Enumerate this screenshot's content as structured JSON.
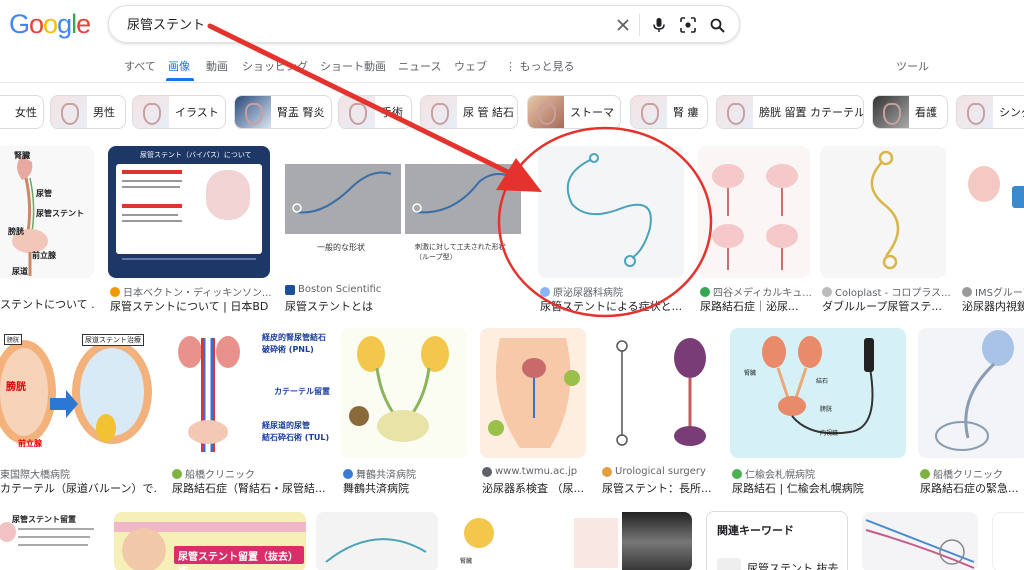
{
  "logo": {
    "letters": [
      "G",
      "o",
      "o",
      "g",
      "l",
      "e"
    ],
    "colors": [
      "#4285F4",
      "#EA4335",
      "#FBBC05",
      "#4285F4",
      "#34A853",
      "#EA4335"
    ]
  },
  "search": {
    "query": "尿管ステント"
  },
  "tabs": [
    {
      "label": "すべて",
      "active": false
    },
    {
      "label": "画像",
      "active": true
    },
    {
      "label": "動画",
      "active": false
    },
    {
      "label": "ショッピング",
      "active": false
    },
    {
      "label": "ショート動画",
      "active": false
    },
    {
      "label": "ニュース",
      "active": false
    },
    {
      "label": "ウェブ",
      "active": false
    },
    {
      "label": "⋮ もっと見る",
      "active": false
    }
  ],
  "tools_label": "ツール",
  "chips": [
    "女性",
    "男性",
    "イラスト",
    "腎盂 腎炎",
    "手術",
    "尿 管 結石",
    "ストーマ",
    "腎 瘻",
    "膀胱 留置 カテーテル",
    "看護",
    "シング"
  ],
  "results_row1": [
    {
      "source": "",
      "title": "ステントについて ..."
    },
    {
      "source": "日本ベクトン・ディッキンソン...",
      "title": "尿管ステントについて | 日本BD"
    },
    {
      "source": "Boston Scientific",
      "title": "尿管ステントとは"
    },
    {
      "source": "原泌尿器科病院",
      "title": "尿管ステントによる症状と..."
    },
    {
      "source": "四谷メディカルキュ...",
      "title": "尿路結石症｜泌尿..."
    },
    {
      "source": "Coloplast - コロプラス...",
      "title": "ダブルループ尿管ステ..."
    },
    {
      "source": "IMSグループ",
      "title": "泌尿器内視鏡"
    }
  ],
  "results_row2": [
    {
      "source": "東国際大橋病院",
      "title": "カテーテル（尿道バルーン）で..."
    },
    {
      "source": "船橋クリニック",
      "title": "尿路結石症（腎結石・尿管結..."
    },
    {
      "source": "舞鶴共済病院",
      "title": "舞鶴共済病院"
    },
    {
      "source": "www.twmu.ac.jp",
      "title": "泌尿器系検査 （尿..."
    },
    {
      "source": "Urological surgery",
      "title": "尿管ステント：長所..."
    },
    {
      "source": "仁楡会札幌病院",
      "title": "尿路結石 | 仁楡会札幌病院"
    },
    {
      "source": "船橋クリニック",
      "title": "尿路結石症の緊急..."
    }
  ],
  "image_texts": {
    "bd_title": "尿管ステント（バイパス）について",
    "boston_left": "一般的な形状",
    "boston_right": "刺激に対して工夫された形状（ループ型）",
    "kidney_label": "腎臓",
    "ureter_label": "尿管",
    "stent_label": "尿管ステント",
    "bladder_label": "膀胱",
    "prostate_label": "前立腺",
    "urethra_label": "尿道",
    "r2_bladder": "膀胱",
    "r2_prostate": "前立腺",
    "r2_urethra_stent": "尿道ステント治療",
    "r2c2_title1": "経皮的腎尿管結石",
    "r2c2_title2": "破砕術 (PNL)",
    "r2c2_catheter": "カテーテル留置",
    "r2c2_title3": "経尿道的尿管",
    "r2c2_title4": "結石砕石術 (TUL)",
    "r2c5_kidney": "腎臓",
    "r2c5_stone": "結石",
    "r2c5_bladder": "膀胱",
    "r2c5_scope": "内視鏡",
    "r3_title": "尿管ステント留置",
    "r3_banner": "尿管ステント留置（抜去）術",
    "r3_kidney": "腎臓"
  },
  "related": {
    "title": "関連キーワード",
    "item": "尿管ステント 抜去"
  },
  "annotation": {
    "arrow_color": "#E5322D",
    "circle_color": "#E5322D"
  }
}
